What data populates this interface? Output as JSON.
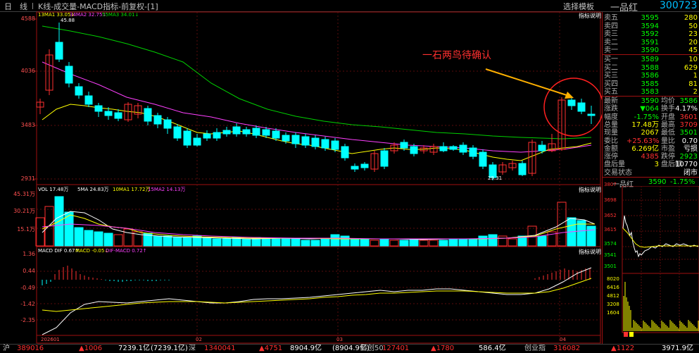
{
  "topbar": {
    "tab_day": "日",
    "tab_line": "线",
    "title": "K线-成交量-MACD指标-前复权-[1]",
    "template_button": "选择模板",
    "stock_name": "一品红",
    "stock_code": "300723",
    "indicator_hint": "指标说明"
  },
  "main_chart": {
    "ma_legend": {
      "ma13": "13MA1 33.05↓",
      "ma34": "34MA2 32.75↓",
      "ma55": "55MA3 34.01↓"
    },
    "y_ticks": [
      "4588",
      "4036",
      "3483",
      "2931"
    ],
    "high_label": "45.88",
    "low_label": "29.31",
    "annotation": "一石两鸟待确认",
    "colors": {
      "up": "#ff3030",
      "down": "#00ffff",
      "ma13": "#ffff00",
      "ma34": "#ff40ff",
      "ma55": "#00e000"
    }
  },
  "volume_chart": {
    "legend": {
      "vol": "VOL 17.48万",
      "ma5": "5MA 24.83万",
      "ma10": "10MA1 17.72万",
      "ma15": "15MA2 14.13万"
    },
    "y_ticks": [
      "45.31万",
      "30.21万",
      "15.1万"
    ]
  },
  "macd_chart": {
    "legend": {
      "dif": "MACD DIF 0.67↑",
      "macd": "MACD -0.05↓",
      "difmacd": "DIF-MACD 0.72↑"
    },
    "y_ticks": [
      "1.36",
      "0.44",
      "-0.49",
      "-1.42",
      "-2.35"
    ]
  },
  "date_axis": [
    "202601",
    "02",
    "03",
    "04"
  ],
  "order_book": {
    "asks": [
      {
        "label": "卖五",
        "price": "3595",
        "vol": "280"
      },
      {
        "label": "卖四",
        "price": "3594",
        "vol": "50"
      },
      {
        "label": "卖三",
        "price": "3592",
        "vol": "23"
      },
      {
        "label": "卖二",
        "price": "3591",
        "vol": "20"
      },
      {
        "label": "卖一",
        "price": "3590",
        "vol": "45"
      }
    ],
    "bids": [
      {
        "label": "买一",
        "price": "3589",
        "vol": "10"
      },
      {
        "label": "买二",
        "price": "3588",
        "vol": "629"
      },
      {
        "label": "买三",
        "price": "3586",
        "vol": "1"
      },
      {
        "label": "买四",
        "price": "3585",
        "vol": "81"
      },
      {
        "label": "买五",
        "price": "3583",
        "vol": "2"
      }
    ]
  },
  "quote": [
    {
      "l1": "最新",
      "v1": "3590",
      "l2": "均价",
      "v2": "3586"
    },
    {
      "l1": "涨跌",
      "v1": "▼064",
      "l2": "换手",
      "v2": "4.17%"
    },
    {
      "l1": "幅度",
      "v1": "-1.75%",
      "l2": "开盘",
      "v2": "3601"
    },
    {
      "l1": "总量",
      "v1": "17.48万",
      "l2": "最高",
      "v2": "3709"
    },
    {
      "l1": "现量",
      "v1": "2067",
      "l2": "最低",
      "v2": "3501"
    },
    {
      "l1": "委比",
      "v1": "+25.63%",
      "l2": "量比",
      "v2": "0.70"
    },
    {
      "l1": "金额",
      "v1": "6.269亿",
      "l2": "市盈",
      "v2": "亏损"
    },
    {
      "l1": "涨停",
      "v1": "4385",
      "l2": "跌停",
      "v2": "2923"
    },
    {
      "l1": "盘后量",
      "v1": "3",
      "l2": "盘后额",
      "v2": "10770"
    },
    {
      "l1": "交易状态",
      "v1": "",
      "l2": "",
      "v2": "闭市"
    }
  ],
  "mini_chart": {
    "name": "一品红",
    "price": "3590",
    "pct": "-1.75%",
    "price_ticks": [
      "3807",
      "3698",
      "3652",
      "3615",
      "3574",
      "3541",
      "3501"
    ],
    "vol_ticks": [
      "8020",
      "6416",
      "4812",
      "3208",
      "1604"
    ]
  },
  "status_bar": [
    {
      "label": "沪",
      "value": "389016",
      "change": "▲1006",
      "amount": "7239.1亿",
      "extra": "(7239.1亿)"
    },
    {
      "label": "深",
      "value": "1340041",
      "change": "▲4751",
      "amount": "8904.9亿",
      "extra": "(8904.9亿)"
    },
    {
      "label": "科创50",
      "value": "127401",
      "change": "▲1780",
      "amount": "586.4亿",
      "extra": ""
    },
    {
      "label": "创业指",
      "value": "316082",
      "change": "▲1122",
      "amount": "3971.9亿",
      "extra": ""
    }
  ]
}
